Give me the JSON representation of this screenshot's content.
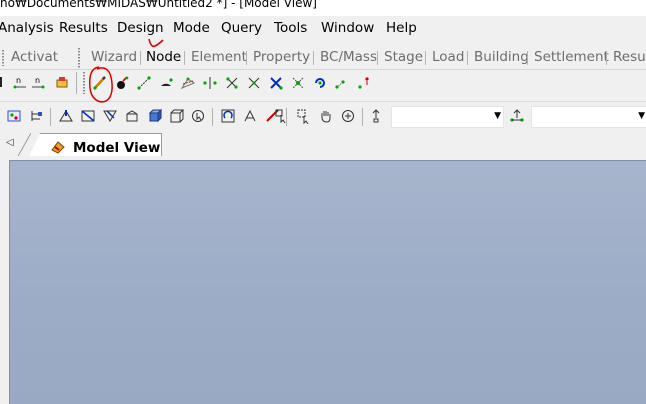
{
  "window": {
    "title": "ho₩Documents₩MIDAS₩Untitled2 *] - [Model View]"
  },
  "menu": {
    "items": [
      {
        "label": "Analysis",
        "name": "menu-analysis"
      },
      {
        "label": "Results",
        "name": "menu-results"
      },
      {
        "label": "Design",
        "name": "menu-design"
      },
      {
        "label": "Mode",
        "name": "menu-mode"
      },
      {
        "label": "Query",
        "name": "menu-query"
      },
      {
        "label": "Tools",
        "name": "menu-tools"
      },
      {
        "label": "Window",
        "name": "menu-window"
      },
      {
        "label": "Help",
        "name": "menu-help"
      }
    ]
  },
  "tree_tabs": {
    "partial_label": "Activat"
  },
  "ribbon_tabs": {
    "items": [
      {
        "label": "Wizard",
        "name": "tab-wizard"
      },
      {
        "label": "Node",
        "name": "tab-node",
        "active": true
      },
      {
        "label": "Element",
        "name": "tab-element"
      },
      {
        "label": "Property",
        "name": "tab-property"
      },
      {
        "label": "BC/Mass",
        "name": "tab-bc-mass"
      },
      {
        "label": "Stage",
        "name": "tab-stage"
      },
      {
        "label": "Load",
        "name": "tab-load"
      },
      {
        "label": "Building",
        "name": "tab-building"
      },
      {
        "label": "Settlement",
        "name": "tab-settlement"
      },
      {
        "label": "Resul",
        "name": "tab-results"
      }
    ]
  },
  "toolbar2": {
    "combo1_value": "",
    "combo2_value": ""
  },
  "document_tabs": {
    "active_label": "Model View"
  },
  "colors": {
    "canvas_top": "#a7b5cc",
    "canvas_bottom": "#9aa9c3",
    "annotation_red": "#e00000",
    "toolbar_bg": "#f0f0f0"
  }
}
